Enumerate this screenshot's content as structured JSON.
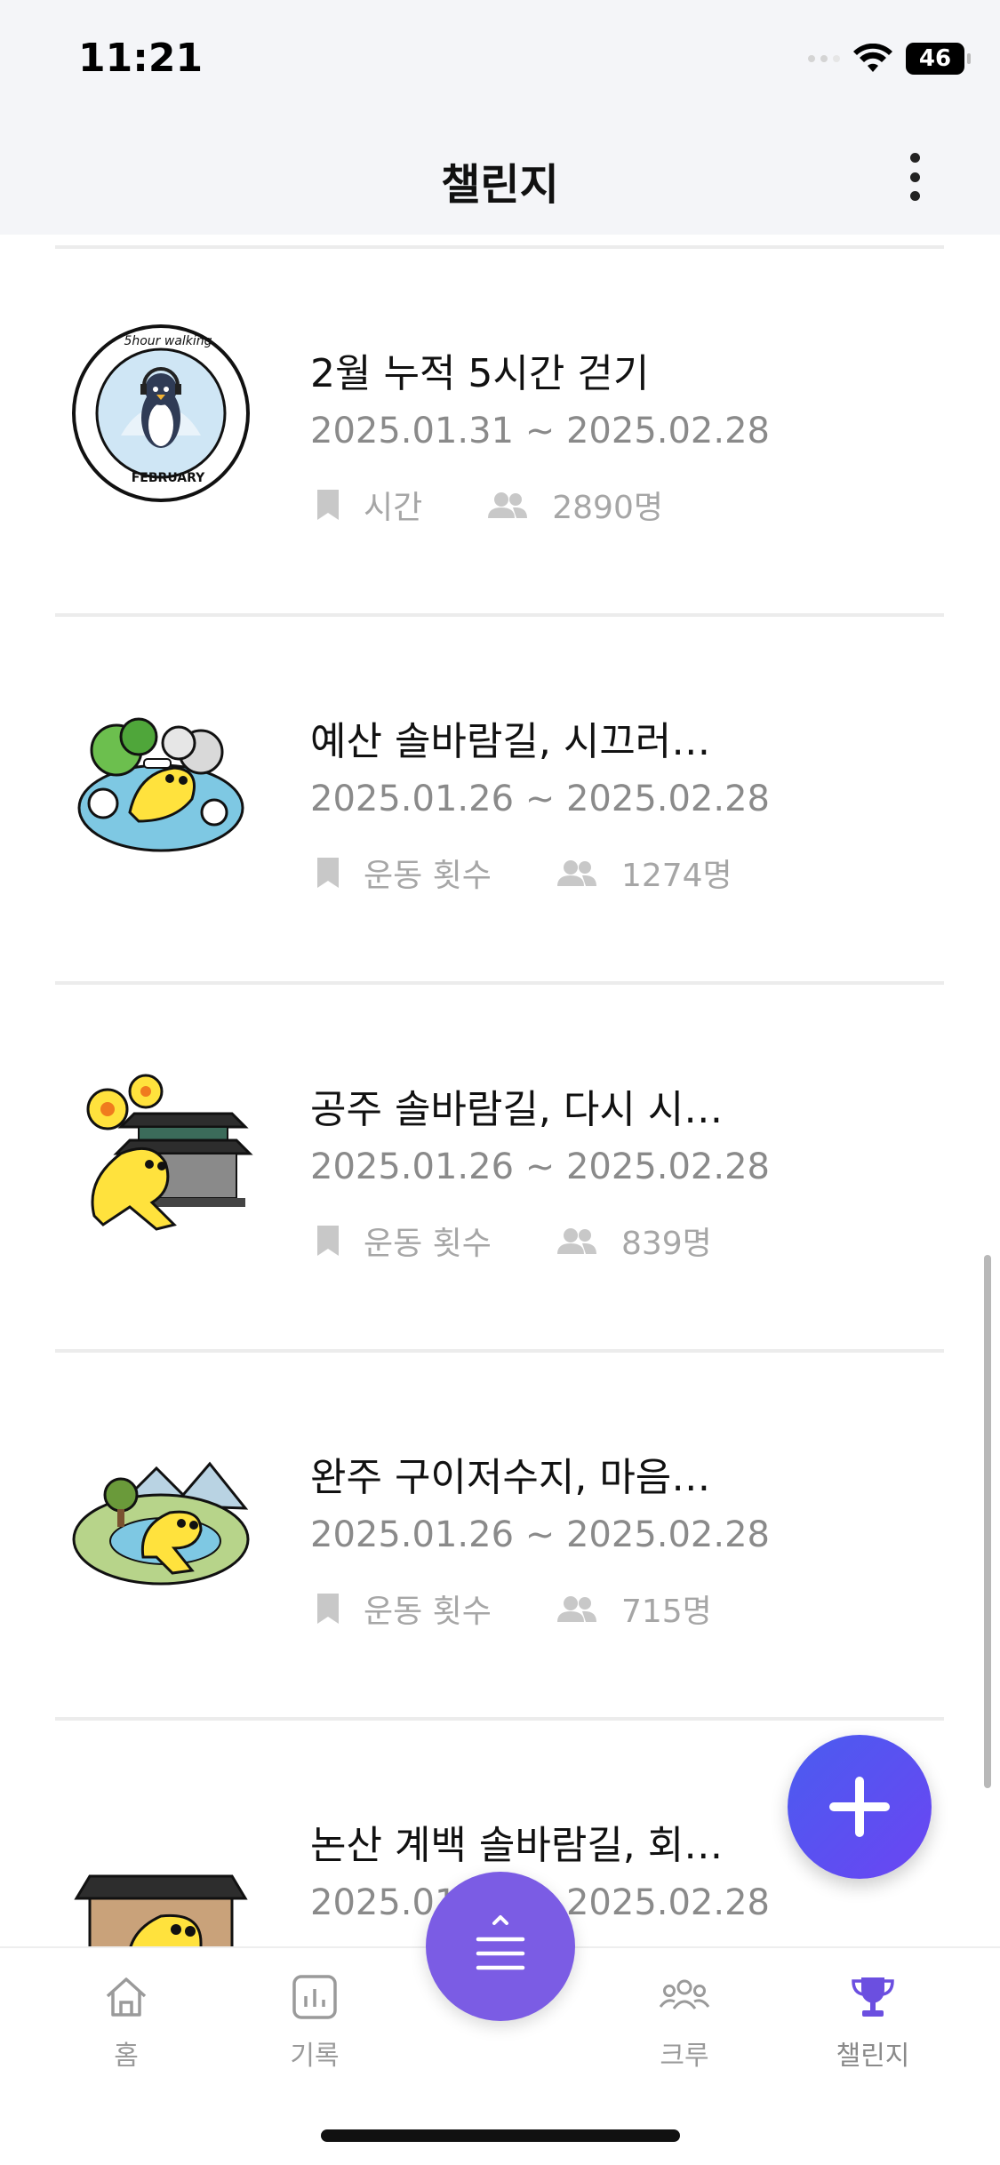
{
  "status_bar": {
    "time": "11:21",
    "battery": "46"
  },
  "header": {
    "title": "챌린지"
  },
  "challenges": [
    {
      "title": "2월 누적 5시간 걷기",
      "date_range": "2025.01.31 ~ 2025.02.28",
      "type": "시간",
      "participants": "2890명",
      "icon": "penguin-badge-icon",
      "badge_top_text": "5hour walking",
      "badge_bottom_text": "FEBRUARY"
    },
    {
      "title": "예산 솔바람길, 시끄러…",
      "date_range": "2025.01.26 ~ 2025.02.28",
      "type": "운동 횟수",
      "participants": "1274명",
      "icon": "hot-spring-character-icon"
    },
    {
      "title": "공주 솔바람길, 다시 시…",
      "date_range": "2025.01.26 ~ 2025.02.28",
      "type": "운동 횟수",
      "participants": "839명",
      "icon": "temple-character-icon"
    },
    {
      "title": "완주 구이저수지, 마음…",
      "date_range": "2025.01.26 ~ 2025.02.28",
      "type": "운동 횟수",
      "participants": "715명",
      "icon": "lake-character-icon"
    },
    {
      "title": "논산 계백 솔바람길, 회…",
      "date_range": "2025.01.26 ~ 2025.02.28",
      "type": "",
      "participants": "",
      "icon": "gate-character-icon"
    }
  ],
  "bottom_nav": {
    "items": [
      {
        "label": "홈",
        "icon": "home-icon"
      },
      {
        "label": "기록",
        "icon": "chart-icon"
      },
      {
        "label": "크루",
        "icon": "crew-icon"
      },
      {
        "label": "챌린지",
        "icon": "trophy-icon",
        "active": true
      }
    ]
  },
  "colors": {
    "accent": "#6b4fe0",
    "fab": "#5b52f0",
    "muted_text": "#8a8a8a"
  }
}
